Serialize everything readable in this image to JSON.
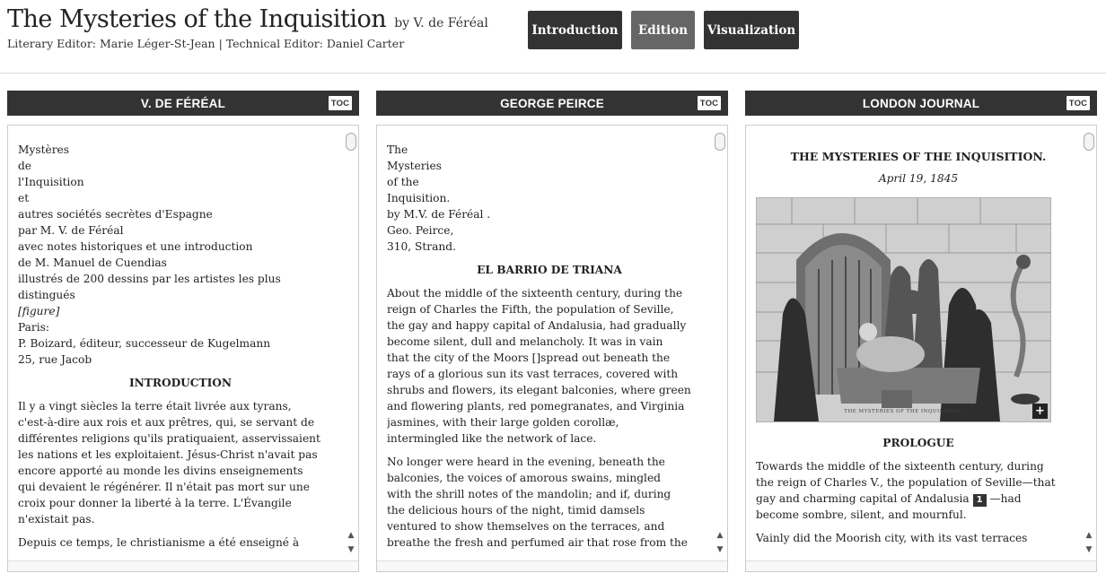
{
  "header": {
    "title": "The Mysteries of the Inquisition",
    "by": "by V. de Féréal",
    "editors": "Literary Editor: Marie Léger-St-Jean | Technical Editor: Daniel Carter"
  },
  "nav": {
    "introduction": "Introduction",
    "edition": "Edition",
    "visualization": "Visualization",
    "active": "Edition"
  },
  "panels": [
    {
      "title": "V. DE FÉRÉAL",
      "toc": "TOC",
      "front_lines": [
        "Mystères",
        "de",
        "l'Inquisition",
        "et",
        "autres sociétés secrètes d'Espagne",
        "par M. V. de Féréal",
        "avec notes historiques et une introduction",
        "de M. Manuel de Cuendias",
        "illustrés de 200 dessins par les artistes les plus",
        "distingués",
        "[figure]",
        "Paris:",
        "P. Boizard, éditeur, successeur de Kugelmann",
        "25, rue Jacob"
      ],
      "heading": "INTRODUCTION",
      "para1_lines": [
        "Il y a vingt siècles la terre était livrée aux tyrans,",
        "c'est-à-dire aux rois et aux prêtres, qui, se servant de",
        "différentes religions qu'ils pratiquaient, asservissaient",
        "les nations et les exploitaient. Jésus-Christ n'avait pas",
        "encore apporté au monde les divins enseignements",
        "qui devaient le régénérer. Il n'était pas mort sur une",
        "croix pour donner la liberté à la terre. L'Évangile",
        "n'existait pas."
      ],
      "para2_lines": [
        "Depuis ce temps, le christianisme a été enseigné à"
      ]
    },
    {
      "title": "GEORGE PEIRCE",
      "toc": "TOC",
      "front_lines": [
        "The",
        "Mysteries",
        "of the",
        "Inquisition.",
        "by M.V. de Féréal .",
        "Geo. Peirce,",
        "310, Strand."
      ],
      "heading": "EL BARRIO DE TRIANA",
      "para1_lines": [
        "About the middle of the sixteenth century, during the",
        "reign of Charles the Fifth, the population of Seville,",
        "the gay and happy capital of Andalusia, had gradually",
        "become silent, dull and melancholy. It was in vain",
        "that the city of the Moors []spread out beneath the",
        "rays of a glorious sun its vast terraces, covered with",
        "shrubs and flowers, its elegant balconies, where green",
        "and flowering plants, red pomegranates, and Virginia",
        "jasmines, with their large golden corollæ,",
        "intermingled like the network of lace."
      ],
      "para2_lines": [
        "No longer were heard in the evening, beneath the",
        "balconies, the voices of amorous swains, mingled",
        "with the shrill notes of the mandolin; and if, during",
        "the delicious hours of the night, timid damsels",
        "ventured to show themselves on the terraces, and",
        "breathe the fresh and perfumed air that rose from the"
      ]
    },
    {
      "title": "LONDON JOURNAL",
      "toc": "TOC",
      "doc_title": "THE MYSTERIES OF THE INQUISITION.",
      "date": "April 19, 1845",
      "image_caption": "THE MYSTERIES OF THE INQUISITION.",
      "expand": "+",
      "heading": "PROLOGUE",
      "para1_line1": "Towards the middle of the sixteenth century, during",
      "para1_line2": "the reign of Charles V., the population of Seville—that",
      "para1_line3a": "gay and charming capital of Andalusia",
      "note_number": "1",
      "para1_line3b": "—had",
      "para1_line4": "become sombre, silent, and mournful.",
      "para2_line1": "Vainly did the Moorish city, with its vast terraces"
    }
  ],
  "scroll": {
    "up_icon": "▲",
    "down_icon": "▼"
  }
}
